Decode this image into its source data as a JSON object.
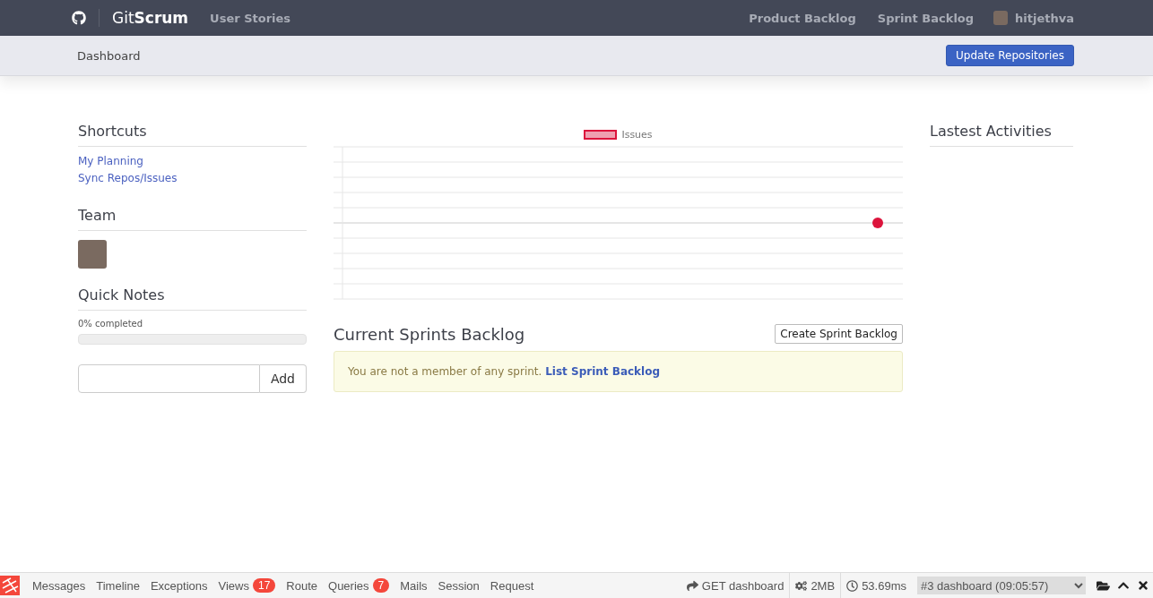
{
  "navbar": {
    "brand_light": "Git",
    "brand_bold": "Scrum",
    "links": [
      {
        "label": "User Stories"
      }
    ],
    "right_links": [
      {
        "label": "Product Backlog"
      },
      {
        "label": "Sprint Backlog"
      }
    ],
    "user": "hitjethva"
  },
  "subbar": {
    "breadcrumb": "Dashboard",
    "button": "Update Repositories"
  },
  "sidebar": {
    "shortcuts_title": "Shortcuts",
    "shortcuts": [
      "My Planning",
      "Sync Repos/Issues"
    ],
    "team_title": "Team",
    "notes_title": "Quick Notes",
    "progress_label": "0% completed",
    "progress": {
      "level": 0
    },
    "add_button": "Add"
  },
  "chart": {
    "legend": "Issues"
  },
  "sprints": {
    "title": "Current Sprints Backlog",
    "button": "Create Sprint Backlog",
    "message": "You are not a member of any sprint.",
    "link": "List Sprint Backlog"
  },
  "activities": {
    "title": "Lastest Activities"
  },
  "debugbar": {
    "tabs": [
      {
        "label": "Messages"
      },
      {
        "label": "Timeline"
      },
      {
        "label": "Exceptions"
      },
      {
        "label": "Views",
        "badge": "17"
      },
      {
        "label": "Route"
      },
      {
        "label": "Queries",
        "badge": "7"
      },
      {
        "label": "Mails"
      },
      {
        "label": "Session"
      },
      {
        "label": "Request"
      }
    ],
    "route": "GET dashboard",
    "memory": "2MB",
    "time": "53.69ms",
    "request": "#3 dashboard (09:05:57)"
  }
}
